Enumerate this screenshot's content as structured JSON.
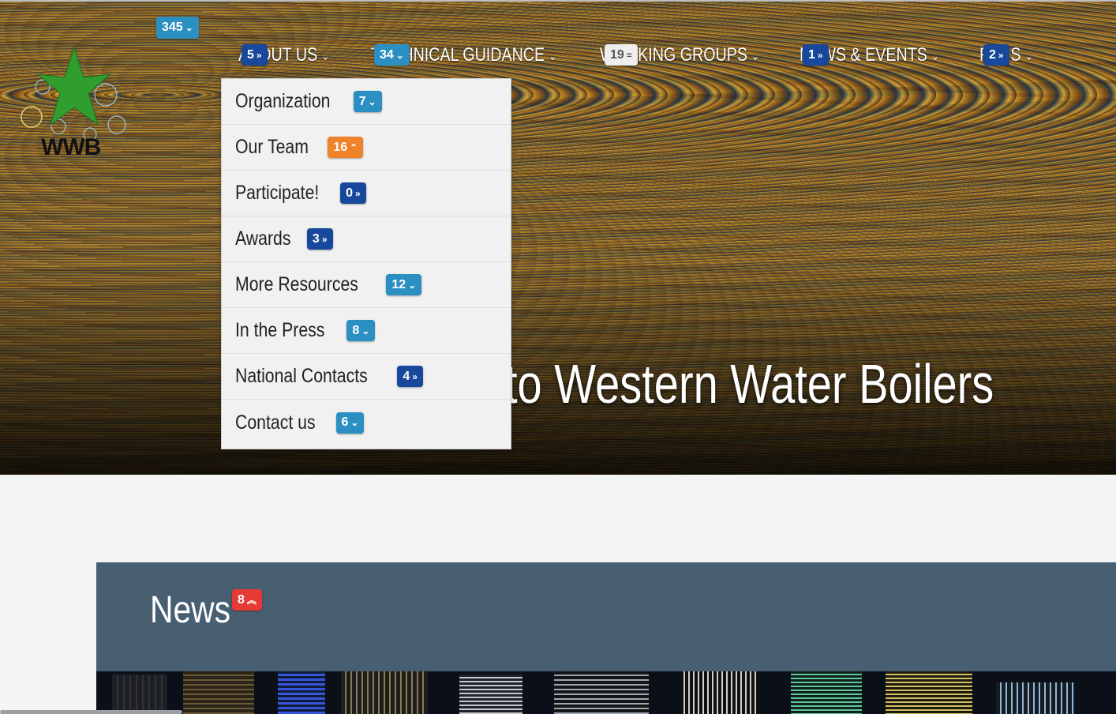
{
  "site": {
    "logo_text": "WWB"
  },
  "nav": {
    "items": [
      {
        "label": "ABOUT US"
      },
      {
        "label": "TECHNICAL GUIDANCE"
      },
      {
        "label": "WORKING GROUPS"
      },
      {
        "label": "NEWS & EVENTS"
      },
      {
        "label": "FAQS"
      }
    ]
  },
  "badges": {
    "logo": {
      "count": "345",
      "icon": "chevron-down"
    },
    "about": {
      "count": "5",
      "icon": "double-chevron-down"
    },
    "technical": {
      "count": "34",
      "icon": "chevron-down"
    },
    "working": {
      "count": "19",
      "icon": "equals"
    },
    "news_events": {
      "count": "1",
      "icon": "double-chevron-down"
    },
    "faqs": {
      "count": "2",
      "icon": "double-chevron-down"
    },
    "news_heading": {
      "count": "8",
      "icon": "double-chevron-up"
    }
  },
  "dropdown": {
    "items": [
      {
        "label": "Organization",
        "count": "7",
        "icon": "chevron-down",
        "color": "light"
      },
      {
        "label": "Our Team",
        "count": "16",
        "icon": "chevron-up",
        "color": "orange"
      },
      {
        "label": "Participate!",
        "count": "0",
        "icon": "double-chevron-down",
        "color": "dark"
      },
      {
        "label": "Awards",
        "count": "3",
        "icon": "double-chevron-down",
        "color": "dark"
      },
      {
        "label": "More Resources",
        "count": "12",
        "icon": "chevron-down",
        "color": "light"
      },
      {
        "label": "In the Press",
        "count": "8",
        "icon": "chevron-down",
        "color": "light"
      },
      {
        "label": "National Contacts",
        "count": "4",
        "icon": "double-chevron-down",
        "color": "dark"
      },
      {
        "label": "Contact us",
        "count": "6",
        "icon": "chevron-down",
        "color": "light"
      }
    ]
  },
  "hero": {
    "title": "to Western Water Boilers"
  },
  "news": {
    "heading": "News"
  },
  "colors": {
    "badge_light": "#2c8fc2",
    "badge_dark": "#17489b",
    "badge_orange": "#f0822a",
    "badge_red": "#e53a33",
    "news_panel": "#485f72",
    "star_green": "#2f9e2f"
  }
}
